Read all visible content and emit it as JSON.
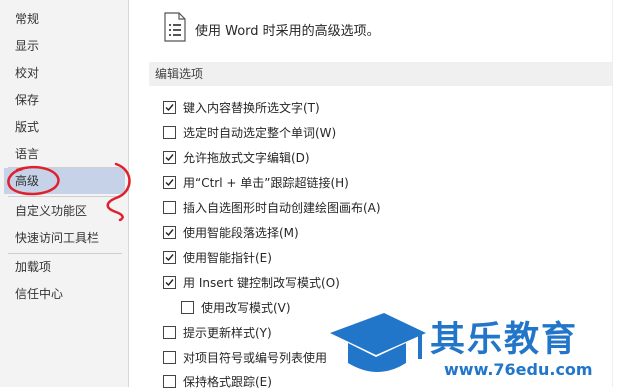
{
  "sidebar": {
    "items": [
      {
        "label": "常规"
      },
      {
        "label": "显示"
      },
      {
        "label": "校对"
      },
      {
        "label": "保存"
      },
      {
        "label": "版式"
      },
      {
        "label": "语言"
      },
      {
        "label": "高级"
      },
      {
        "label": "自定义功能区"
      },
      {
        "label": "快速访问工具栏"
      },
      {
        "label": "加载项"
      },
      {
        "label": "信任中心"
      }
    ],
    "selected_index": 6
  },
  "main": {
    "header_text": "使用 Word 时采用的高级选项。",
    "section_title": "编辑选项",
    "options": [
      {
        "label": "键入内容替换所选文字(T)",
        "checked": true
      },
      {
        "label": "选定时自动选定整个单词(W)",
        "checked": false
      },
      {
        "label": "允许拖放式文字编辑(D)",
        "checked": true
      },
      {
        "label": "用“Ctrl + 单击”跟踪超链接(H)",
        "checked": true
      },
      {
        "label": "插入自选图形时自动创建绘图画布(A)",
        "checked": false
      },
      {
        "label": "使用智能段落选择(M)",
        "checked": true
      },
      {
        "label": "使用智能指针(E)",
        "checked": true
      },
      {
        "label": "用 Insert 键控制改写模式(O)",
        "checked": true
      },
      {
        "label": "使用改写模式(V)",
        "checked": false
      },
      {
        "label": "提示更新样式(Y)",
        "checked": false
      },
      {
        "label": "对项目符号或编号列表使用",
        "checked": false
      },
      {
        "label": "保持格式跟踪(E)",
        "checked": false
      }
    ]
  },
  "watermark": {
    "brand": "其乐教育",
    "url": "www.76edu.com"
  },
  "colors": {
    "selected_bg": "#c5d2e8",
    "annotation_red": "#e0202a",
    "watermark_blue": "#2276c9"
  }
}
